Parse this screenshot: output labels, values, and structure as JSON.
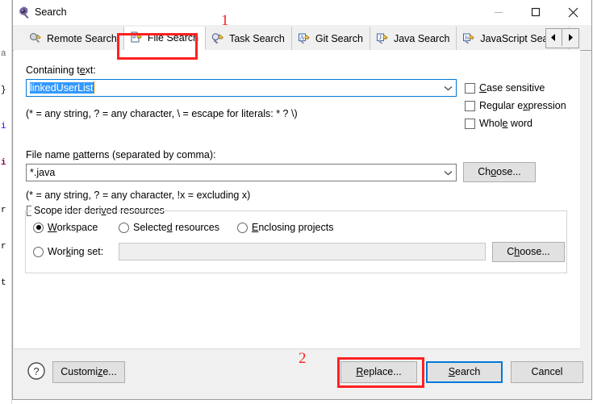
{
  "window": {
    "title": "Search",
    "icon": "search-gear-icon",
    "controls": {
      "minimize": "minimize-icon",
      "maximize": "maximize-icon",
      "close": "close-icon"
    }
  },
  "tabs": {
    "items": [
      {
        "label": "Remote Search",
        "icon": "remote-search-icon",
        "selected": false
      },
      {
        "label": "File Search",
        "icon": "file-search-icon",
        "selected": true
      },
      {
        "label": "Task Search",
        "icon": "task-search-icon",
        "selected": false
      },
      {
        "label": "Git Search",
        "icon": "git-search-icon",
        "selected": false
      },
      {
        "label": "Java Search",
        "icon": "java-search-icon",
        "selected": false
      },
      {
        "label": "JavaScript Search",
        "icon": "javascript-search-icon",
        "selected": false
      }
    ],
    "scroll_left": "scroll-left-icon",
    "scroll_right": "scroll-right-icon"
  },
  "form": {
    "containing_text_label": "Containing text:",
    "containing_text_label_mnemonic": "e",
    "containing_text_value": "linkedUserList",
    "containing_text_hint": "(* = any string, ? = any character, \\ = escape for literals: * ? \\)",
    "options": [
      {
        "label": "Case sensitive",
        "mnemonic": "C",
        "checked": false
      },
      {
        "label": "Regular expression",
        "mnemonic": "x",
        "checked": false
      },
      {
        "label": "Whole word",
        "mnemonic": "e",
        "checked": false
      }
    ],
    "file_patterns_label": "File name patterns (separated by comma):",
    "file_patterns_label_mnemonic": "p",
    "file_patterns_value": "*.java",
    "file_patterns_hint": "(* = any string, ? = any character, !x = excluding x)",
    "choose_patterns_label": "Choose...",
    "choose_patterns_mnemonic": "o",
    "consider_derived": {
      "label": "Consider derived resources",
      "mnemonic": "v",
      "checked": false
    }
  },
  "scope": {
    "legend": "Scope",
    "radios": [
      {
        "label": "Workspace",
        "mnemonic": "W",
        "checked": true
      },
      {
        "label": "Selected resources",
        "mnemonic": "d",
        "checked": false
      },
      {
        "label": "Enclosing projects",
        "mnemonic": "E",
        "checked": false
      },
      {
        "label": "Working set:",
        "mnemonic": "k",
        "checked": false
      }
    ],
    "working_set_value": "",
    "choose_working_set_label": "Choose...",
    "choose_working_set_mnemonic": "h"
  },
  "footer": {
    "help_icon": "help-icon",
    "customize_label": "Customize...",
    "customize_mnemonic": "z",
    "replace_label": "Replace...",
    "replace_mnemonic": "R",
    "search_label": "Search",
    "search_mnemonic": "S",
    "cancel_label": "Cancel"
  },
  "annotations": [
    {
      "number": "1",
      "target": "file-search-tab"
    },
    {
      "number": "2",
      "target": "replace-button"
    }
  ],
  "colors": {
    "annotation_red": "#ff2020",
    "focus_blue": "#0078d7",
    "selection_blue": "#3399ff",
    "dialog_bg": "#f0f0f0",
    "page_bg": "#ffffff"
  },
  "background_editor": {
    "visible_fragments": [
      "a",
      "}",
      "i",
      "i",
      "r",
      "r",
      "t"
    ]
  }
}
